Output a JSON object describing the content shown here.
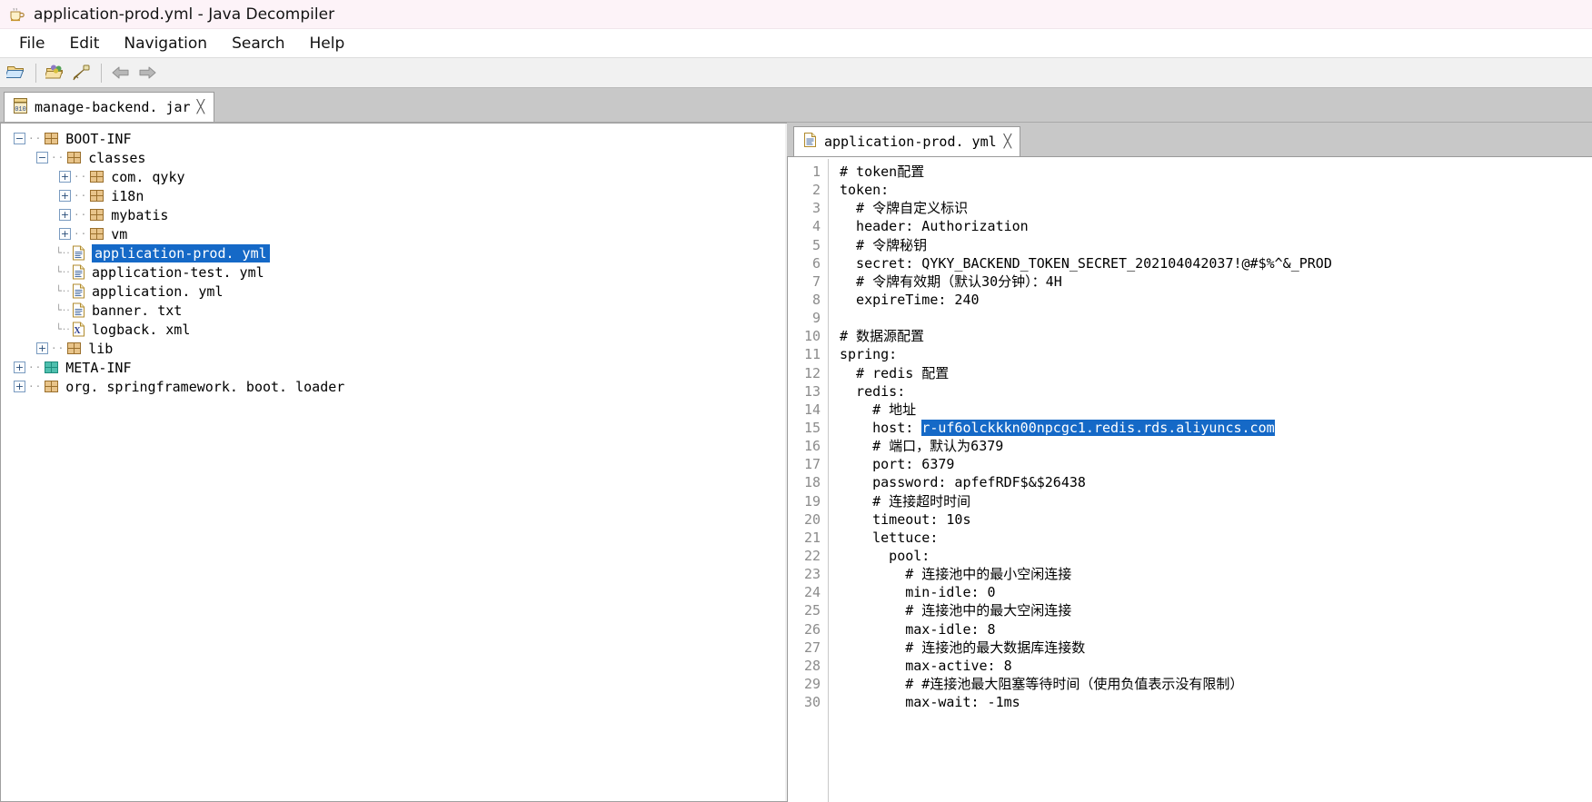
{
  "window": {
    "title": "application-prod.yml - Java Decompiler",
    "icon": "java-coffee-cup-icon"
  },
  "menubar": {
    "items": [
      {
        "label": "File",
        "name": "menu-file"
      },
      {
        "label": "Edit",
        "name": "menu-edit"
      },
      {
        "label": "Navigation",
        "name": "menu-navigation"
      },
      {
        "label": "Search",
        "name": "menu-search"
      },
      {
        "label": "Help",
        "name": "menu-help"
      }
    ]
  },
  "toolbar": {
    "buttons": [
      {
        "name": "open-file-icon",
        "title": "Open File"
      },
      {
        "name": "open-type-icon",
        "title": "Open Type"
      },
      {
        "name": "open-type-hierarchy-icon",
        "title": "Open Type Hierarchy"
      },
      {
        "name": "back-arrow-icon",
        "title": "Back"
      },
      {
        "name": "forward-arrow-icon",
        "title": "Forward"
      }
    ]
  },
  "jar_tabs": [
    {
      "label": "manage-backend. jar",
      "icon": "jar-archive-icon",
      "close": "╳"
    }
  ],
  "tree": {
    "nodes": [
      {
        "label": "BOOT-INF",
        "depth": 0,
        "toggle": "minus",
        "icon": "package-folder-icon",
        "selected": false
      },
      {
        "label": "classes",
        "depth": 1,
        "toggle": "minus",
        "icon": "package-folder-icon",
        "selected": false
      },
      {
        "label": "com. qyky",
        "depth": 2,
        "toggle": "plus",
        "icon": "package-folder-icon",
        "selected": false
      },
      {
        "label": "i18n",
        "depth": 2,
        "toggle": "plus",
        "icon": "package-folder-icon",
        "selected": false
      },
      {
        "label": "mybatis",
        "depth": 2,
        "toggle": "plus",
        "icon": "package-folder-icon",
        "selected": false
      },
      {
        "label": "vm",
        "depth": 2,
        "toggle": "plus",
        "icon": "package-folder-icon",
        "selected": false
      },
      {
        "label": "application-prod. yml",
        "depth": 2,
        "toggle": "leaf",
        "icon": "text-file-icon",
        "selected": true
      },
      {
        "label": "application-test. yml",
        "depth": 2,
        "toggle": "leaf",
        "icon": "text-file-icon",
        "selected": false
      },
      {
        "label": "application. yml",
        "depth": 2,
        "toggle": "leaf",
        "icon": "text-file-icon",
        "selected": false
      },
      {
        "label": "banner. txt",
        "depth": 2,
        "toggle": "leaf",
        "icon": "text-file-icon",
        "selected": false
      },
      {
        "label": "logback. xml",
        "depth": 2,
        "toggle": "leaf",
        "icon": "xml-file-icon",
        "selected": false
      },
      {
        "label": "lib",
        "depth": 1,
        "toggle": "plus",
        "icon": "package-folder-icon",
        "selected": false
      },
      {
        "label": "META-INF",
        "depth": 0,
        "toggle": "plus",
        "icon": "package-folder-teal-icon",
        "selected": false
      },
      {
        "label": "org. springframework. boot. loader",
        "depth": 0,
        "toggle": "plus",
        "icon": "package-folder-icon",
        "selected": false
      }
    ]
  },
  "editor": {
    "tabs": [
      {
        "label": "application-prod. yml",
        "icon": "text-file-icon",
        "close": "╳",
        "active": true
      }
    ],
    "line_numbers": [
      1,
      2,
      3,
      4,
      5,
      6,
      7,
      8,
      9,
      10,
      11,
      12,
      13,
      14,
      15,
      16,
      17,
      18,
      19,
      20,
      21,
      22,
      23,
      24,
      25,
      26,
      27,
      28,
      29,
      30
    ],
    "lines": [
      {
        "n": 1,
        "text": "# token配置"
      },
      {
        "n": 2,
        "text": "token:"
      },
      {
        "n": 3,
        "text": "  # 令牌自定义标识"
      },
      {
        "n": 4,
        "text": "  header: Authorization"
      },
      {
        "n": 5,
        "text": "  # 令牌秘钥"
      },
      {
        "n": 6,
        "text": "  secret: QYKY_BACKEND_TOKEN_SECRET_202104042037!@#$%^&_PROD"
      },
      {
        "n": 7,
        "text": "  # 令牌有效期（默认30分钟）：4H"
      },
      {
        "n": 8,
        "text": "  expireTime: 240"
      },
      {
        "n": 9,
        "text": ""
      },
      {
        "n": 10,
        "text": "# 数据源配置"
      },
      {
        "n": 11,
        "text": "spring:"
      },
      {
        "n": 12,
        "text": "  # redis 配置"
      },
      {
        "n": 13,
        "text": "  redis:"
      },
      {
        "n": 14,
        "text": "    # 地址"
      },
      {
        "n": 15,
        "text": "    host: ",
        "highlight": "r-uf6olckkkn00npcgc1.redis.rds.aliyuncs.com"
      },
      {
        "n": 16,
        "text": "    # 端口，默认为6379"
      },
      {
        "n": 17,
        "text": "    port: 6379"
      },
      {
        "n": 18,
        "text": "    password: apfefRDF$&$26438"
      },
      {
        "n": 19,
        "text": "    # 连接超时时间"
      },
      {
        "n": 20,
        "text": "    timeout: 10s"
      },
      {
        "n": 21,
        "text": "    lettuce:"
      },
      {
        "n": 22,
        "text": "      pool:"
      },
      {
        "n": 23,
        "text": "        # 连接池中的最小空闲连接"
      },
      {
        "n": 24,
        "text": "        min-idle: 0"
      },
      {
        "n": 25,
        "text": "        # 连接池中的最大空闲连接"
      },
      {
        "n": 26,
        "text": "        max-idle: 8"
      },
      {
        "n": 27,
        "text": "        # 连接池的最大数据库连接数"
      },
      {
        "n": 28,
        "text": "        max-active: 8"
      },
      {
        "n": 29,
        "text": "        # #连接池最大阻塞等待时间（使用负值表示没有限制）"
      },
      {
        "n": 30,
        "text": "        max-wait: -1ms"
      }
    ]
  },
  "colors": {
    "title_bg": "#fdf3f8",
    "selection": "#1569c7",
    "tabstrip_bg": "#c8c8c8",
    "toolbar_bg": "#f1f1f1",
    "gutter_text": "#8c8c8c"
  }
}
